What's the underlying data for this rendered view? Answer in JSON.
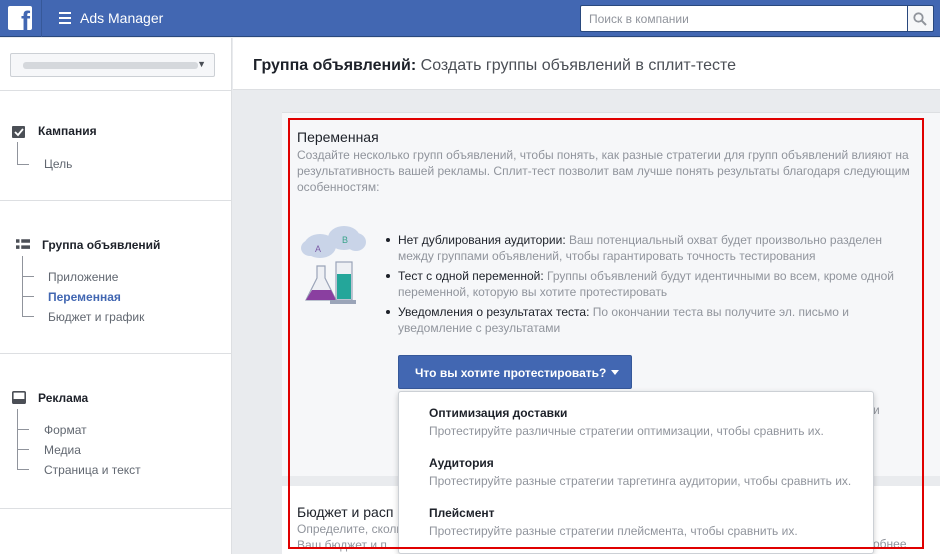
{
  "topbar": {
    "logo_letter": "f",
    "app_title": "Ads Manager",
    "search_placeholder": "Поиск в компании"
  },
  "sidebar": {
    "account_caret": "▼",
    "sections": [
      {
        "title": "Кампания",
        "items": [
          "Цель"
        ]
      },
      {
        "title": "Группа объявлений",
        "items": [
          "Приложение",
          "Переменная",
          "Бюджет и график"
        ],
        "active": "Переменная"
      },
      {
        "title": "Реклама",
        "items": [
          "Формат",
          "Медиа",
          "Страница и текст"
        ]
      }
    ]
  },
  "header": {
    "bold": "Группа объявлений:",
    "rest": " Создать группы объявлений в сплит-тесте"
  },
  "variable": {
    "title": "Переменная",
    "description": "Создайте несколько групп объявлений, чтобы понять, как разные стратегии для групп объявлений влияют на результативность вашей рекламы. Сплит-тест позволит вам лучше понять результаты благодаря следующим особенностям:",
    "bullets": [
      {
        "head": "Нет дублирования аудитории:",
        "text": " Ваш потенциальный охват будет произвольно разделен между группами объявлений, чтобы гарантировать точность тестирования"
      },
      {
        "head": "Тест с одной переменной:",
        "text": " Группы объявлений будут идентичными во всем, кроме одной переменной, которую вы хотите протестировать"
      },
      {
        "head": "Уведомления о результатах теста:",
        "text": " По окончании теста вы получите эл. письмо и уведомление с результатами"
      }
    ],
    "illustration_labels": [
      "A",
      "B"
    ],
    "test_button": "Что вы хотите протестировать?",
    "hidden_right_char": "и"
  },
  "dropdown": {
    "options": [
      {
        "title": "Оптимизация доставки",
        "desc": "Протестируйте различные стратегии оптимизации, чтобы сравнить их."
      },
      {
        "title": "Аудитория",
        "desc": "Протестируйте разные стратегии таргетинга аудитории, чтобы сравнить их."
      },
      {
        "title": "Плейсмент",
        "desc": "Протестируйте разные стратегии плейсмента, чтобы сравнить их."
      }
    ]
  },
  "budget": {
    "title_partial": "Бюджет и расп",
    "desc_line1": "Определите, скольк",
    "desc_line2": "Ваш бюджет и п",
    "right_partial": "обнее"
  },
  "colors": {
    "brand": "#4267b2",
    "highlight": "#e00000"
  }
}
